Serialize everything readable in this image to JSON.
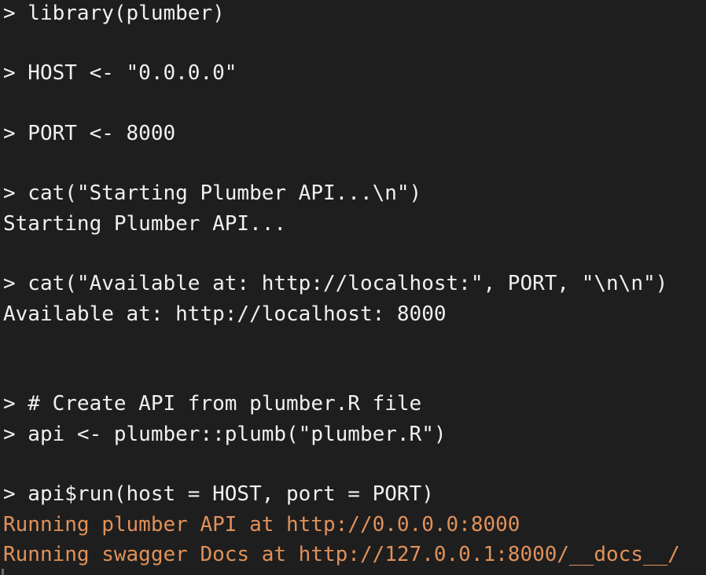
{
  "console": {
    "lines": [
      "> library(plumber)",
      "> HOST <- \"0.0.0.0\"",
      "> PORT <- 8000",
      "> cat(\"Starting Plumber API...\\n\")",
      "Starting Plumber API...",
      "> cat(\"Available at: http://localhost:\", PORT, \"\\n\\n\")",
      "Available at: http://localhost: 8000",
      "> # Create API from plumber.R file",
      "> api <- plumber::plumb(\"plumber.R\")",
      "> api$run(host = HOST, port = PORT)",
      "Running plumber API at http://0.0.0.0:8000",
      "Running swagger Docs at http://127.0.0.1:8000/__docs__/"
    ]
  },
  "colors": {
    "background": "#1e1e1e",
    "text": "#f0f0f0",
    "message": "#e0915a"
  }
}
